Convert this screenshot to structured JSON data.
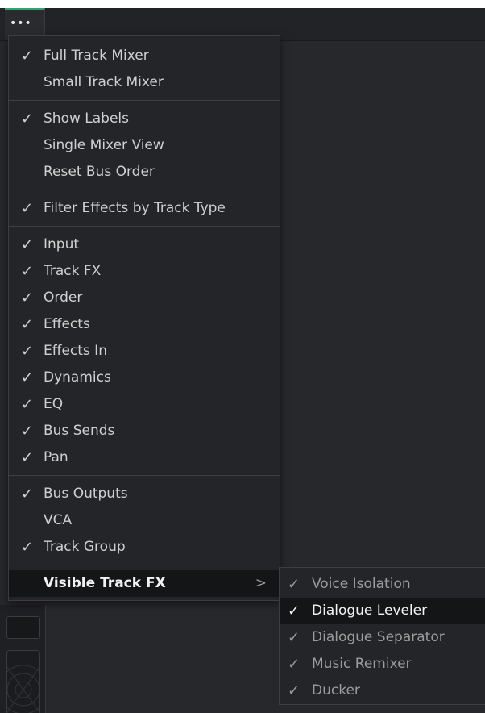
{
  "toolbar": {
    "more_label": "•••",
    "accent_color": "#2fa76a"
  },
  "menu": {
    "groups": [
      [
        {
          "label": "Full Track Mixer",
          "checked": true
        },
        {
          "label": "Small Track Mixer",
          "checked": false
        }
      ],
      [
        {
          "label": "Show Labels",
          "checked": true
        },
        {
          "label": "Single Mixer View",
          "checked": false
        },
        {
          "label": "Reset Bus Order",
          "checked": false
        }
      ],
      [
        {
          "label": "Filter Effects by Track Type",
          "checked": true
        }
      ],
      [
        {
          "label": "Input",
          "checked": true
        },
        {
          "label": "Track FX",
          "checked": true
        },
        {
          "label": "Order",
          "checked": true
        },
        {
          "label": "Effects",
          "checked": true
        },
        {
          "label": "Effects In",
          "checked": true
        },
        {
          "label": "Dynamics",
          "checked": true
        },
        {
          "label": "EQ",
          "checked": true
        },
        {
          "label": "Bus Sends",
          "checked": true
        },
        {
          "label": "Pan",
          "checked": true
        }
      ],
      [
        {
          "label": "Bus Outputs",
          "checked": true
        },
        {
          "label": "VCA",
          "checked": false
        },
        {
          "label": "Track Group",
          "checked": true
        }
      ]
    ],
    "submenu_trigger": {
      "label": "Visible Track FX",
      "chevron": ">"
    },
    "check_glyph": "✓"
  },
  "submenu": {
    "items": [
      {
        "label": "Voice Isolation",
        "checked": true,
        "highlighted": false
      },
      {
        "label": "Dialogue Leveler",
        "checked": true,
        "highlighted": true
      },
      {
        "label": "Dialogue Separator",
        "checked": true,
        "highlighted": false
      },
      {
        "label": "Music Remixer",
        "checked": true,
        "highlighted": false
      },
      {
        "label": "Ducker",
        "checked": true,
        "highlighted": false
      }
    ]
  }
}
